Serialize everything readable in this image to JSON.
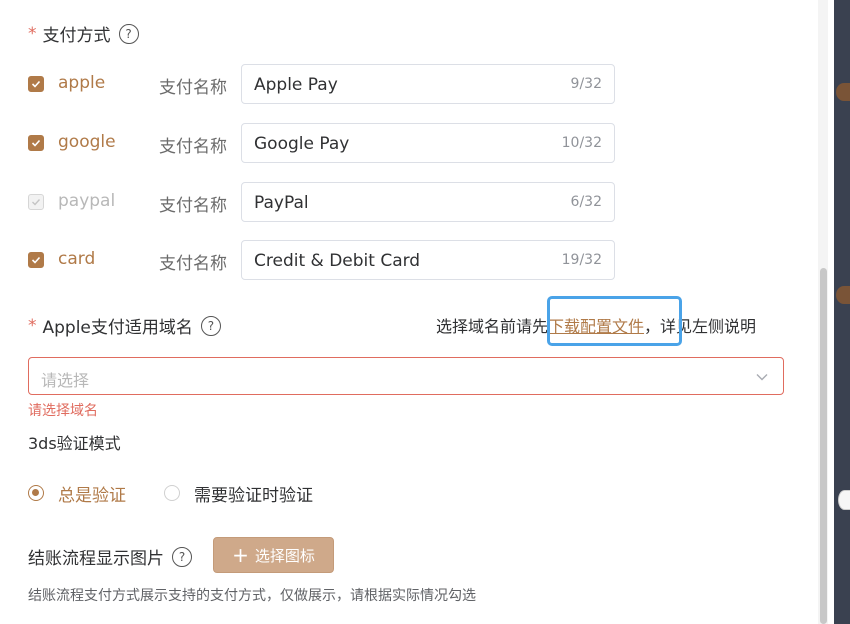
{
  "payment": {
    "label": "支付方式",
    "required_mark": "*",
    "help": "?",
    "name_label": "支付名称",
    "methods": [
      {
        "method": "apple",
        "checked": true,
        "name": "Apple Pay",
        "counter": "9/32"
      },
      {
        "method": "google",
        "checked": true,
        "name": "Google Pay",
        "counter": "10/32"
      },
      {
        "method": "paypal",
        "checked": false,
        "name": "PayPal",
        "counter": "6/32"
      },
      {
        "method": "card",
        "checked": true,
        "name": "Credit & Debit Card",
        "counter": "19/32"
      }
    ]
  },
  "apple_domain": {
    "label": "Apple支付适用域名",
    "required_mark": "*",
    "help": "?",
    "note_prefix": "选择域名前请先",
    "note_link": "下载配置文件",
    "note_suffix": "，详见左侧说明",
    "placeholder": "请选择",
    "error": "请选择域名"
  },
  "three_ds": {
    "label": "3ds验证模式",
    "options": [
      {
        "label": "总是验证",
        "selected": true
      },
      {
        "label": "需要验证时验证",
        "selected": false
      }
    ]
  },
  "checkout_image": {
    "label": "结账流程显示图片",
    "help": "?",
    "button_label": "选择图标",
    "hint": "结账流程支付方式展示支持的支付方式，仅做展示，请根据实际情况勾选"
  },
  "colors": {
    "accent": "#b07a48",
    "error": "#e06c5f",
    "highlight": "#4aa3e8"
  }
}
